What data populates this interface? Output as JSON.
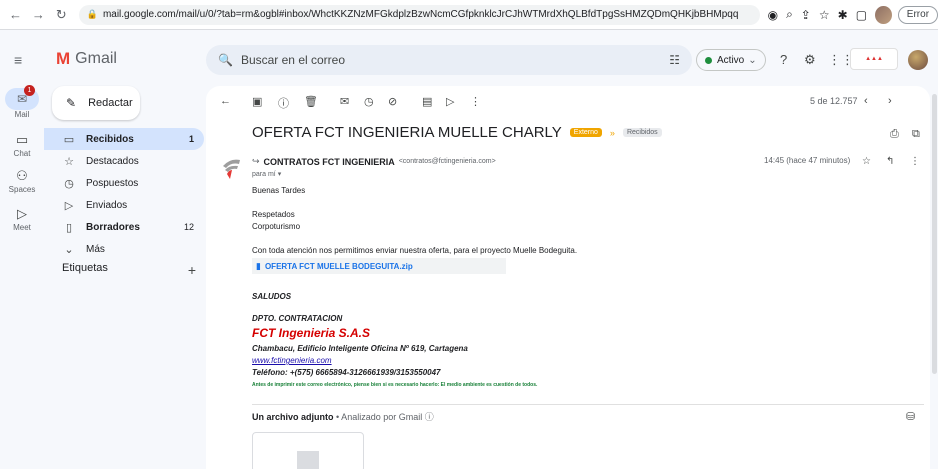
{
  "browser": {
    "url": "mail.google.com/mail/u/0/?tab=rm&ogbl#inbox/WhctKKZNzMFGkdplzBzwNcmCGfpknklcJrCJhWTMrdXhQLBfdTpgSsHMZQDmQHKjbBHMpqq",
    "error_label": "Error"
  },
  "rail": {
    "mail_label": "Mail",
    "mail_badge": "1",
    "chat_label": "Chat",
    "spaces_label": "Spaces",
    "meet_label": "Meet"
  },
  "header": {
    "app_name": "Gmail",
    "search_placeholder": "Buscar en el correo",
    "status_label": "Activo"
  },
  "sidebar": {
    "compose_label": "Redactar",
    "items": [
      {
        "label": "Recibidos",
        "count": "1",
        "icon": "inbox-icon"
      },
      {
        "label": "Destacados",
        "count": "",
        "icon": "star-icon"
      },
      {
        "label": "Pospuestos",
        "count": "",
        "icon": "clock-icon"
      },
      {
        "label": "Enviados",
        "count": "",
        "icon": "send-icon"
      },
      {
        "label": "Borradores",
        "count": "12",
        "icon": "draft-icon"
      },
      {
        "label": "Más",
        "count": "",
        "icon": "chevron-down-icon"
      }
    ],
    "labels_title": "Etiquetas"
  },
  "toolbar": {
    "pager": "5 de 12.757"
  },
  "email": {
    "subject": "OFERTA FCT INGENIERIA MUELLE CHARLY",
    "tag_external": "Externo",
    "tag_inbox": "Recibidos",
    "sender_name": "CONTRATOS FCT INGENIERIA",
    "sender_email": "<contratos@fctingenieria.com>",
    "to": "para mí",
    "time": "14:45 (hace 47 minutos)",
    "greeting": "Buenas Tardes",
    "salutation1": "Respetados",
    "salutation2": "Corpoturismo",
    "body_text": "Con toda atención nos permitimos enviar nuestra oferta, para el proyecto Muelle Bodeguita.",
    "attachment_name": "OFERTA FCT MUELLE BODEGUITA.zip",
    "closing": "SALUDOS",
    "dept": "DPTO. CONTRATACION",
    "company": "FCT Ingenieria S.A.S",
    "address": "Chambacu, Edificio Inteligente Oficina Nº 619, Cartagena",
    "website": "www.fctingenieria.com",
    "phone": "Teléfono: +(575) 6665894-3126661939/3153550047",
    "eco_note": "Antes de imprimir este correo electrónico, piense bien si es necesario hacerlo: El medio ambiente es cuestión de todos.",
    "attachments_title": "Un archivo adjunto",
    "attachments_scanned": "• Analizado por Gmail ⓘ"
  },
  "colors": {
    "accent": "#d3e3fd",
    "external_tag": "#f0a500",
    "company_red": "#d50000"
  }
}
